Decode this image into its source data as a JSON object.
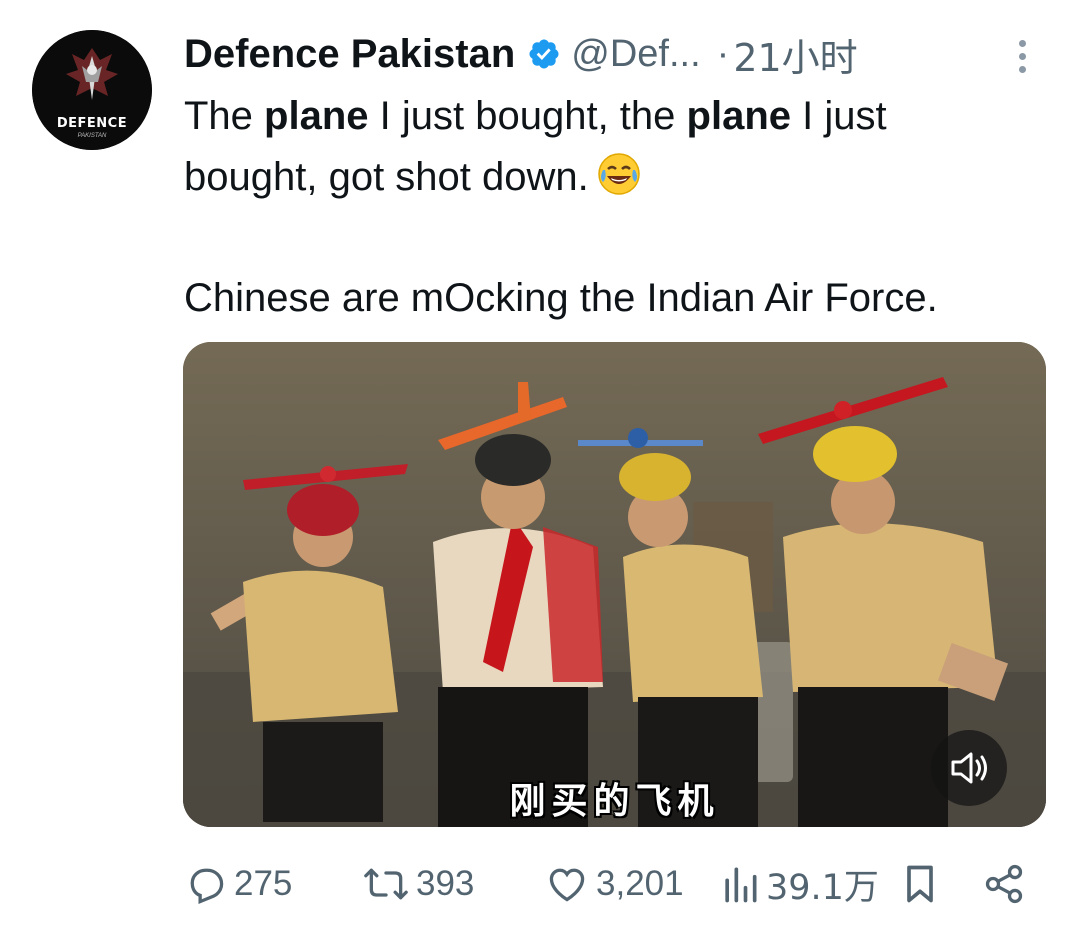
{
  "tweet": {
    "author_name": "Defence Pakistan",
    "handle": "@Def...",
    "separator": "·",
    "time": "21小时",
    "avatar_label": "DEFENCE",
    "avatar_sublabel": "PAKISTAN",
    "text": {
      "line1_a": "The ",
      "line1_bold1": "plane",
      "line1_b": " I just bought, the ",
      "line1_bold2": "plane",
      "line1_c": " I just",
      "line2": "bought, got shot down.",
      "line3": "Chinese are mOcking the Indian Air Force."
    },
    "emoji": "face-with-tears-of-joy-icon",
    "media": {
      "subtitle": "刚买的飞机",
      "sound_icon": "speaker-icon"
    },
    "actions": {
      "replies": "275",
      "retweets": "393",
      "likes": "3,201",
      "views": "39.1万"
    }
  },
  "colors": {
    "text": "#0f1419",
    "muted": "#536471",
    "verified": "#1d9bf0"
  }
}
